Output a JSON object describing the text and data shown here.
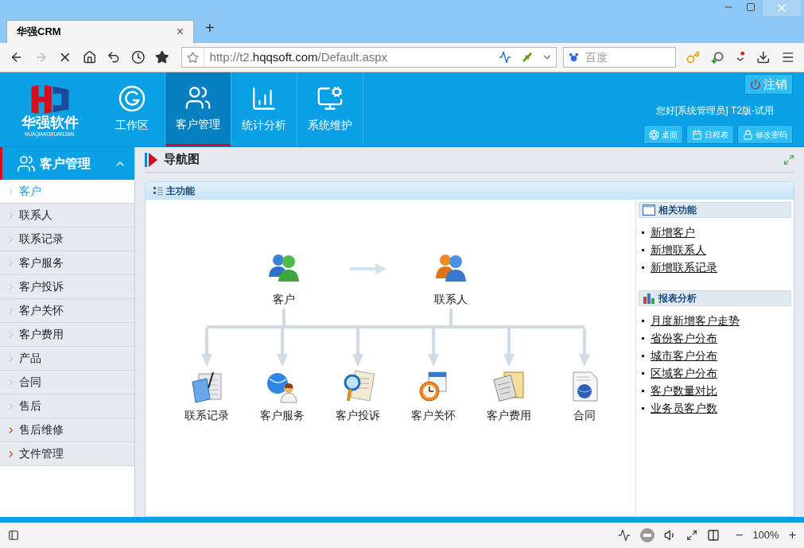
{
  "window": {
    "tab_title": "华强CRM",
    "tab_close": "×",
    "new_tab": "+"
  },
  "address_bar": {
    "url_prefix": "http://t2.",
    "url_domain": "hqqsoft.com",
    "url_path": "/Default.aspx"
  },
  "search": {
    "placeholder": "百度"
  },
  "app_header": {
    "logo_text": "华强软件",
    "logo_subtext": "HUAQIANGRUANJIAN",
    "nav": [
      {
        "label": "工作区",
        "kind": "workspace",
        "selected": false
      },
      {
        "label": "客户管理",
        "kind": "customers",
        "selected": true
      },
      {
        "label": "统计分析",
        "kind": "statistics",
        "selected": false
      },
      {
        "label": "系统维护",
        "kind": "system",
        "selected": false
      }
    ],
    "logout": "注销",
    "greeting": "您好[系统管理员] T2版-试用",
    "quick_buttons": [
      {
        "label": "桌面",
        "kind": "desktop"
      },
      {
        "label": "日程表",
        "kind": "schedule"
      },
      {
        "label": "修改密码",
        "kind": "password"
      }
    ]
  },
  "sidebar": {
    "title": "客户管理",
    "expanded": true,
    "items": [
      {
        "label": "客户",
        "selected": true,
        "expandable": false
      },
      {
        "label": "联系人",
        "selected": false,
        "expandable": false
      },
      {
        "label": "联系记录",
        "selected": false,
        "expandable": false
      },
      {
        "label": "客户服务",
        "selected": false,
        "expandable": false
      },
      {
        "label": "客户投诉",
        "selected": false,
        "expandable": false
      },
      {
        "label": "客户关怀",
        "selected": false,
        "expandable": false
      },
      {
        "label": "客户费用",
        "selected": false,
        "expandable": false
      },
      {
        "label": "产品",
        "selected": false,
        "expandable": false
      },
      {
        "label": "合同",
        "selected": false,
        "expandable": false
      },
      {
        "label": "售后",
        "selected": false,
        "expandable": false
      },
      {
        "label": "售后维修",
        "selected": false,
        "expandable": true
      },
      {
        "label": "文件管理",
        "selected": false,
        "expandable": true
      }
    ]
  },
  "page": {
    "title": "导航图",
    "panel_title": "主功能",
    "diagram": {
      "top_nodes": [
        {
          "label": "客户",
          "kind": "customer"
        },
        {
          "label": "联系人",
          "kind": "contact"
        }
      ],
      "bottom_nodes": [
        {
          "label": "联系记录",
          "kind": "record"
        },
        {
          "label": "客户服务",
          "kind": "service"
        },
        {
          "label": "客户投诉",
          "kind": "complaint"
        },
        {
          "label": "客户关怀",
          "kind": "care"
        },
        {
          "label": "客户费用",
          "kind": "fee"
        },
        {
          "label": "合同",
          "kind": "contract"
        }
      ]
    },
    "side_sections": [
      {
        "title": "相关功能",
        "kind": "functions",
        "links": [
          "新增客户",
          "新增联系人",
          "新增联系记录"
        ]
      },
      {
        "title": "报表分析",
        "kind": "reports",
        "links": [
          "月度新增客户走势",
          "省份客户分布",
          "城市客户分布",
          "区域客户分布",
          "客户数量对比",
          "业务员客户数"
        ]
      }
    ]
  },
  "status_bar": {
    "zoom": "100%",
    "zoom_out": "−",
    "zoom_in": "+"
  }
}
